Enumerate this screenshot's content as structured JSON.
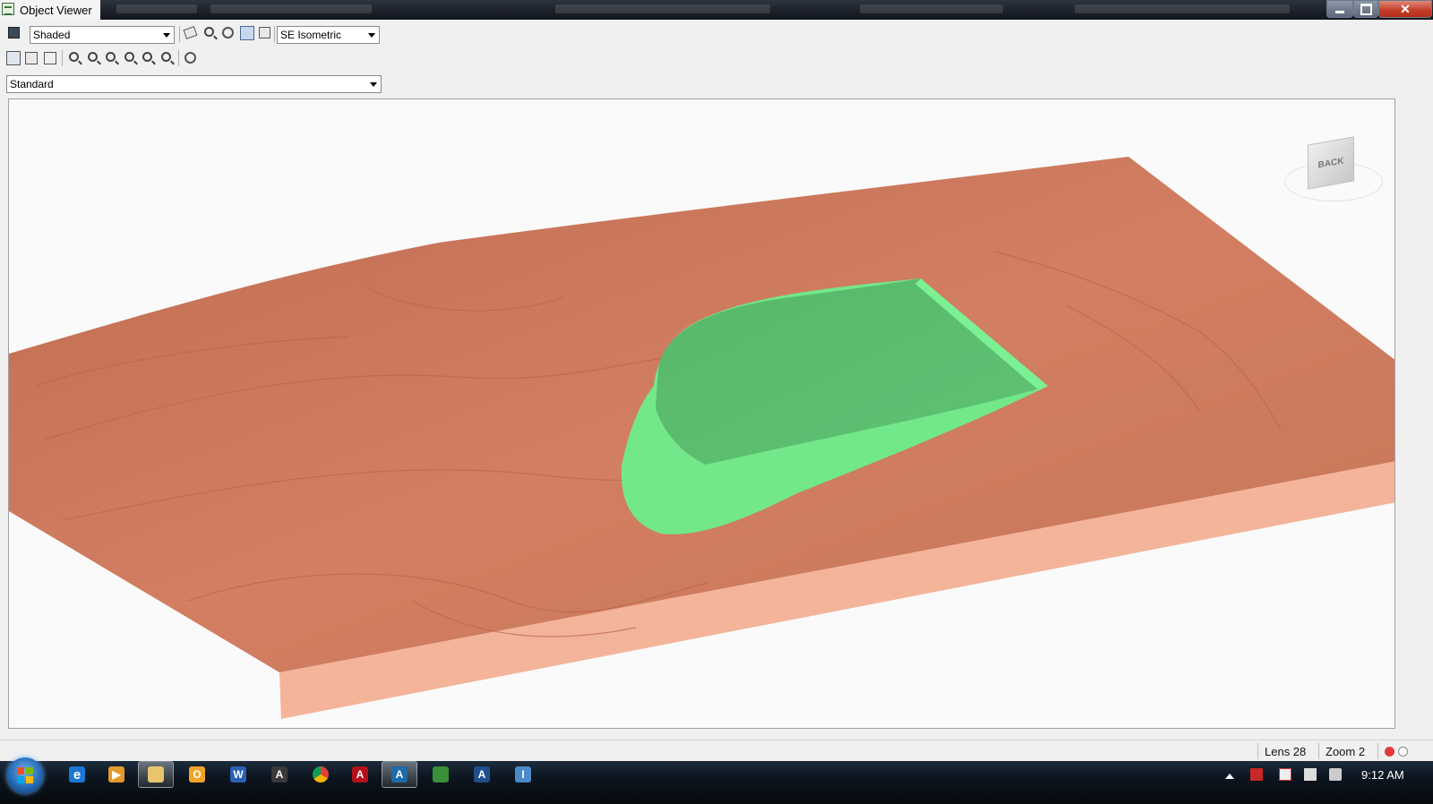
{
  "window": {
    "title": "Object Viewer",
    "controls": {
      "minimize": "minimize",
      "maximize": "maximize",
      "close": "✕"
    }
  },
  "toolbar": {
    "visual_style": "Shaded",
    "view_preset": "SE Isometric",
    "named_view": "Standard"
  },
  "viewcube": {
    "face_label": "BACK"
  },
  "status": {
    "lens": "Lens 28",
    "zoom": "Zoom 2"
  },
  "taskbar": {
    "clock": "9:12 AM",
    "apps": [
      "internet-explorer",
      "media-player",
      "file-explorer",
      "outlook",
      "word",
      "autocad-tool",
      "chrome",
      "acrobat",
      "civil3d",
      "excel-like",
      "autocad",
      "infraworks"
    ]
  },
  "colors": {
    "surface_top": "#c97a5e",
    "surface_side": "#f4b49a",
    "pond": "#5fc273",
    "pond_light": "#72e88a",
    "viewport_bg": "#fafafa"
  }
}
